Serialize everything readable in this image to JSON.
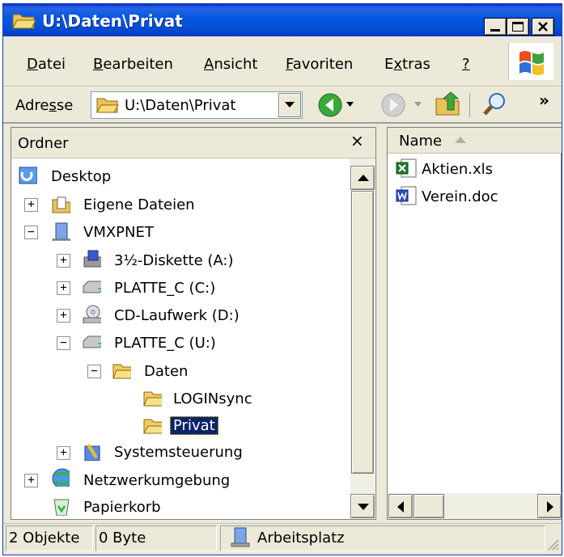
{
  "window": {
    "title": "U:\\Daten\\Privat"
  },
  "menu": {
    "items": [
      {
        "pre": "",
        "key": "D",
        "post": "atei"
      },
      {
        "pre": "",
        "key": "B",
        "post": "earbeiten"
      },
      {
        "pre": "",
        "key": "A",
        "post": "nsicht"
      },
      {
        "pre": "",
        "key": "F",
        "post": "avoriten"
      },
      {
        "pre": "E",
        "key": "x",
        "post": "tras"
      },
      {
        "pre": "",
        "key": "?",
        "post": ""
      }
    ]
  },
  "address": {
    "label_pre": "Adre",
    "label_key": "s",
    "label_post": "se",
    "value": "U:\\Daten\\Privat",
    "more": "»"
  },
  "folders": {
    "header": "Ordner",
    "close": "×",
    "tree": [
      {
        "label": "Desktop",
        "icon": "desktop-icon",
        "expander": ""
      },
      {
        "label": "Eigene Dateien",
        "icon": "my-documents-icon",
        "expander": "+"
      },
      {
        "label": "VMXPNET",
        "icon": "computer-icon",
        "expander": "−"
      },
      {
        "label": "3½-Diskette (A:)",
        "icon": "floppy-icon",
        "expander": "+"
      },
      {
        "label": "PLATTE_C (C:)",
        "icon": "drive-icon",
        "expander": "+"
      },
      {
        "label": "CD-Laufwerk (D:)",
        "icon": "cd-drive-icon",
        "expander": "+"
      },
      {
        "label": "PLATTE_C (U:)",
        "icon": "drive-icon",
        "expander": "−"
      },
      {
        "label": "Daten",
        "icon": "folder-icon",
        "expander": "−"
      },
      {
        "label": "LOGINsync",
        "icon": "folder-icon",
        "expander": ""
      },
      {
        "label": "Privat",
        "icon": "folder-open-icon",
        "expander": ""
      },
      {
        "label": "Systemsteuerung",
        "icon": "control-panel-icon",
        "expander": "+"
      },
      {
        "label": "Netzwerkumgebung",
        "icon": "network-icon",
        "expander": "+"
      },
      {
        "label": "Papierkorb",
        "icon": "recycle-bin-icon",
        "expander": ""
      }
    ]
  },
  "files": {
    "column_name": "Name",
    "items": [
      {
        "name": "Aktien.xls",
        "icon": "excel-file-icon"
      },
      {
        "name": "Verein.doc",
        "icon": "word-file-icon"
      }
    ]
  },
  "status": {
    "objects": "2 Objekte",
    "size": "0 Byte",
    "location": "Arbeitsplatz"
  },
  "colors": {
    "titlebar": "#0558e2",
    "selection": "#0a246a",
    "chrome": "#ece9d8"
  }
}
